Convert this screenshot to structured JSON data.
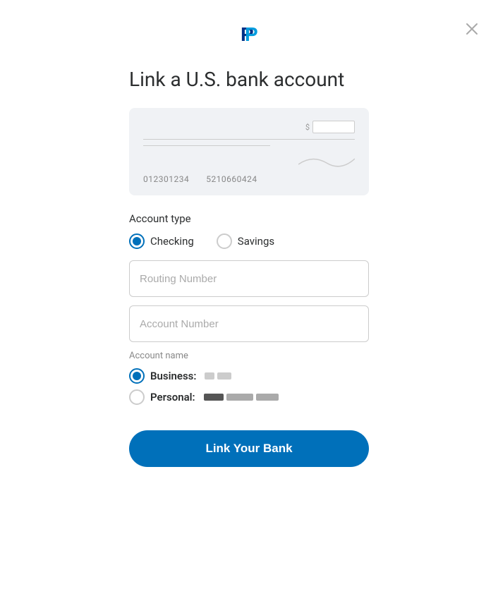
{
  "modal": {
    "title": "Link a U.S. bank account",
    "close_label": "×"
  },
  "check": {
    "routing_number": "012301234",
    "account_number": "5210660424"
  },
  "account_type": {
    "label": "Account type",
    "options": [
      "Checking",
      "Savings"
    ],
    "selected": "Checking"
  },
  "routing_input": {
    "placeholder": "Routing Number"
  },
  "account_input": {
    "placeholder": "Account Number"
  },
  "account_name": {
    "label": "Account name",
    "business_label": "Business:",
    "personal_label": "Personal:",
    "selected": "Business"
  },
  "cta": {
    "label": "Link Your Bank"
  },
  "paypal_logo": {
    "letter": "P"
  }
}
